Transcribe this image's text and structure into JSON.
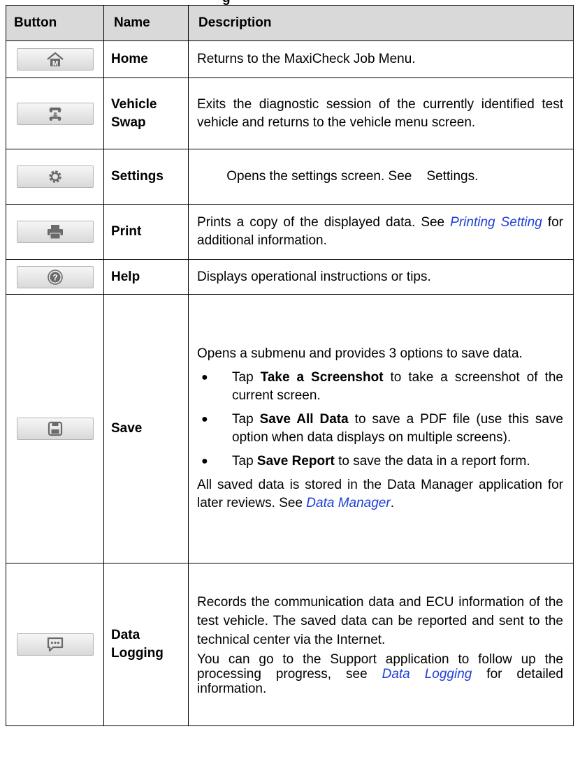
{
  "page": {
    "caption_fragment": "g"
  },
  "table": {
    "headers": {
      "button": "Button",
      "name": "Name",
      "description": "Description"
    },
    "rows": {
      "home": {
        "icon": "home-icon",
        "name": "Home",
        "desc": "Returns to the MaxiCheck Job Menu."
      },
      "vehicle_swap": {
        "icon": "vehicle-swap-icon",
        "name_1": "Vehicle",
        "name_2": "Swap",
        "desc": "Exits the diagnostic session of the currently identified test vehicle and returns to the vehicle menu screen."
      },
      "settings": {
        "icon": "gear-icon",
        "name": "Settings",
        "desc": "Opens the settings screen. See    Settings."
      },
      "print": {
        "icon": "printer-icon",
        "name": "Print",
        "desc_1": "Prints a copy of the displayed data. See ",
        "link": "Printing Setting",
        "desc_2": " for additional information."
      },
      "help": {
        "icon": "help-icon",
        "name": "Help",
        "desc": "Displays operational instructions or tips."
      },
      "save": {
        "icon": "floppy-disk-icon",
        "name": "Save",
        "intro": "Opens a submenu and provides 3 options to save data.",
        "bullets": [
          {
            "pre": "Tap ",
            "bold": "Take a Screenshot",
            "post": " to take a screenshot of the current screen."
          },
          {
            "pre": "Tap ",
            "bold": "Save All Data",
            "post": " to save a PDF file (use this save option when data displays on multiple screens)."
          },
          {
            "pre": "Tap ",
            "bold": "Save Report",
            "post": " to save the data in a report form."
          }
        ],
        "outro_1": "All saved data is stored in the Data Manager application for later reviews. See ",
        "outro_link": "Data Manager",
        "outro_2": "."
      },
      "data_logging": {
        "icon": "chat-bubble-icon",
        "name_1": "Data",
        "name_2": "Logging",
        "desc_1": "Records the communication data and ECU information of the test vehicle. The saved data can be reported and sent to the technical center via the Internet.",
        "desc_2_pre": "You can go to the Support application to follow up the processing progress, see ",
        "desc_2_link": "Data Logging",
        "desc_2_post": " for detailed information."
      }
    }
  }
}
